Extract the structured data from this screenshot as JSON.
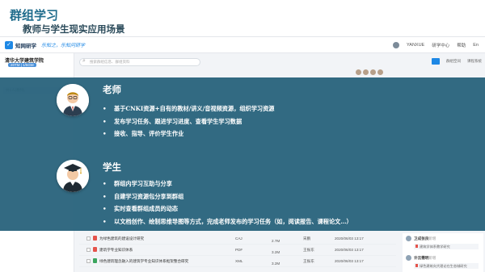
{
  "slide": {
    "title": "群组学习",
    "subtitle": "教师与学生现实应用场景"
  },
  "app": {
    "brand": "知网研学",
    "slogan": "乐知之，乐知问研学",
    "top_right": [
      "YANXUE",
      "研学中心",
      "帮助",
      "En"
    ],
    "org_name": "清华大学建筑学院",
    "org_sub": "20TM | 1/5GM",
    "sidebar_hint": "共1人(教师)",
    "search_placeholder": "搜索群组信息、群组资料",
    "toolbar_right": [
      "群组空间",
      "课程系统"
    ]
  },
  "teacher": {
    "title": "老师",
    "icon": "teacher-avatar-icon",
    "items": [
      "基于CNKI资源+自有的教材/讲义/音视频资源，组织学习资源",
      "发布学习任务、跟进学习进度、查看学生学习数据",
      "接收、指导、评价学生作业"
    ]
  },
  "student": {
    "title": "学生",
    "icon": "graduate-avatar-icon",
    "items": [
      "群组内学习互助与分享",
      "自建学习资源包分享到群组",
      "实时查看群组成员的动态",
      "以文档创作、绘制思维导图等方式，完成老师发布的学习任务（如，阅读报告、课程论文…）"
    ]
  },
  "files": {
    "rows": [
      {
        "name": "为绿色建筑的建设设计研究",
        "type": "CAJ",
        "size": "2.7M",
        "owner": "宋鹏",
        "date": "2020/06/03 13:17",
        "icon": "pdf-file-icon",
        "checked": false
      },
      {
        "name": "建筑学专业知识体系",
        "type": "PDF",
        "size": "3.2M",
        "owner": "王振东",
        "date": "2020/06/03 13:17",
        "icon": "pdf-file-icon",
        "checked": true
      },
      {
        "name": "绿色建筑理念融入的建筑学专业知识体系框架整合研究",
        "type": "XML",
        "size": "3.2M",
        "owner": "王振东",
        "date": "2020/06/03 13:17",
        "icon": "xml-file-icon",
        "checked": true
      }
    ]
  },
  "activity": {
    "items": [
      {
        "name": "卫成张良",
        "action": "新增",
        "card": "建筑学体系教学研究"
      },
      {
        "name": "许云需明",
        "action": "新增",
        "card": "绿色建筑向大理论在生态城研究"
      }
    ]
  },
  "colors": {
    "overlay": "#245f78",
    "title": "#1f6c8c",
    "accent": "#1e88e5"
  }
}
